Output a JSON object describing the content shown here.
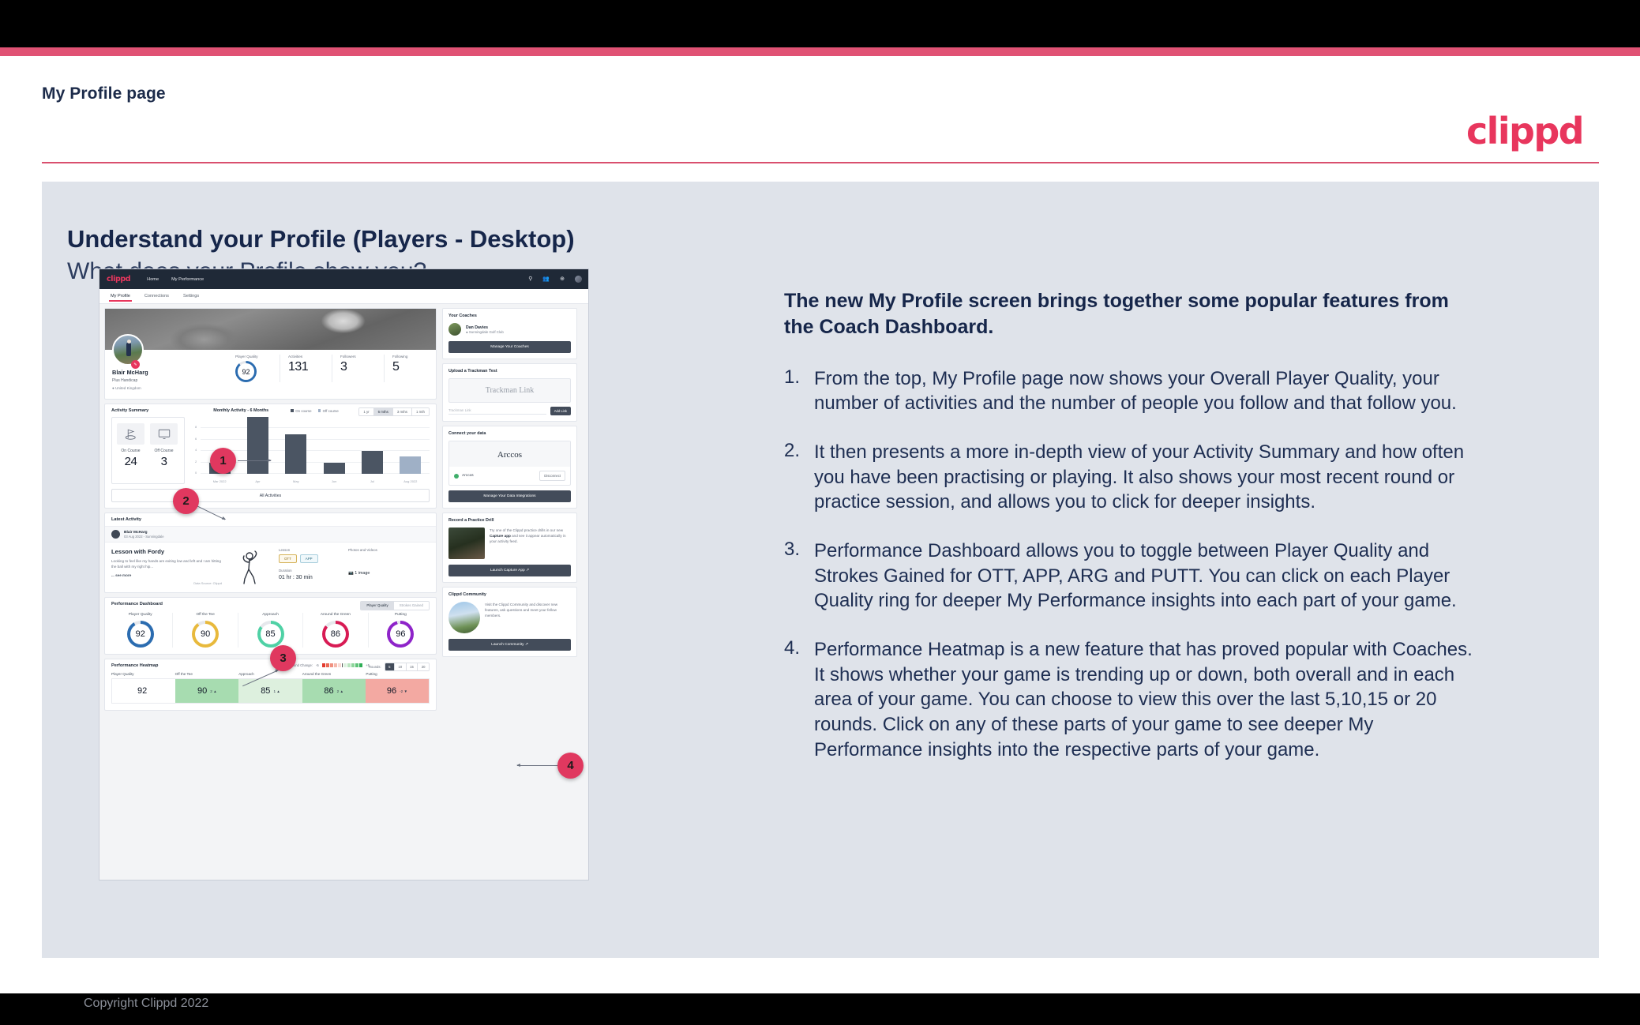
{
  "slide": {
    "page_title": "My Profile page",
    "logo": "clippd",
    "heading": "Understand your Profile (Players - Desktop)",
    "subheading": "What does your Profile show you?",
    "copyright": "Copyright Clippd 2022",
    "accent_color": "#e05274",
    "panel_color": "#dfe3ea",
    "brand_pink": "#e8365d"
  },
  "explanation": {
    "intro": "The new My Profile screen brings together some popular features from the Coach Dashboard.",
    "items": [
      {
        "num": "1.",
        "text": "From the top, My Profile page now shows your Overall Player Quality, your number of activities and the number of people you follow and that follow you."
      },
      {
        "num": "2.",
        "text": "It then presents a more in-depth view of your Activity Summary and how often you have been practising or playing. It also shows your most recent round or practice session, and allows you to click for deeper insights."
      },
      {
        "num": "3.",
        "text": "Performance Dashboard allows you to toggle between Player Quality and Strokes Gained for OTT, APP, ARG and PUTT. You can click on each Player Quality ring for deeper My Performance insights into each part of your game."
      },
      {
        "num": "4.",
        "text": "Performance Heatmap is a new feature that has proved popular with Coaches. It shows whether your game is trending up or down, both overall and in each area of your game. You can choose to view this over the last 5,10,15 or 20 rounds. Click on any of these parts of your game to see deeper My Performance insights into the respective parts of your game."
      }
    ]
  },
  "callouts": [
    {
      "label": "1"
    },
    {
      "label": "2"
    },
    {
      "label": "3"
    },
    {
      "label": "4"
    }
  ],
  "app": {
    "logo": "clippd",
    "nav": [
      "Home",
      "My Performance"
    ],
    "nav_icons": [
      "search-icon",
      "people-icon",
      "add-circle-icon",
      "avatar-icon"
    ],
    "tabs": [
      {
        "label": "My Profile",
        "active": true
      },
      {
        "label": "Connections",
        "active": false
      },
      {
        "label": "Settings",
        "active": false
      }
    ],
    "profile": {
      "name": "Blair McHarg",
      "handicap": "Plus Handicap",
      "location": "United Kingdom",
      "stats": [
        {
          "label": "Player Quality",
          "value": "92",
          "type": "ring",
          "color": "#2b6cb0"
        },
        {
          "label": "Activities",
          "value": "131"
        },
        {
          "label": "Followers",
          "value": "3"
        },
        {
          "label": "Following",
          "value": "5"
        }
      ]
    },
    "activity_summary": {
      "title": "Activity Summary",
      "chart_title": "Monthly Activity - 6 Months",
      "legend": [
        {
          "label": "On course",
          "color": "#4b5563"
        },
        {
          "label": "Off course",
          "color": "#9fb0c6"
        }
      ],
      "ranges": [
        {
          "label": "1 yr",
          "active": false
        },
        {
          "label": "6 mths",
          "active": true
        },
        {
          "label": "3 mths",
          "active": false
        },
        {
          "label": "1 mth",
          "active": false
        }
      ],
      "counters": [
        {
          "label": "On Course",
          "value": "24",
          "icon": "golf-flag-icon"
        },
        {
          "label": "Off Course",
          "value": "3",
          "icon": "monitor-icon"
        }
      ],
      "all_activities_label": "All Activities"
    },
    "latest_activity": {
      "title": "Latest Activity",
      "user": "Blair McHarg",
      "date": "03 Aug 2022 - Sunningdale",
      "lesson_title": "Lesson with Fordy",
      "description": "Looking to feel like my hands are exiting low and left and I am hitting the ball with my right hip...",
      "see_more": "... see more",
      "data_source": "Data Source: Clippd",
      "type_label": "Lesson",
      "chips": [
        "OTT",
        "APP"
      ],
      "duration_label": "Duration",
      "duration_value": "01 hr : 30 min",
      "media_label": "Photos and Videos",
      "media_value": "1 image"
    },
    "performance_dashboard": {
      "title": "Performance Dashboard",
      "toggle": [
        {
          "label": "Player Quality",
          "active": true
        },
        {
          "label": "Strokes Gained",
          "active": false
        }
      ],
      "rings": [
        {
          "label": "Player Quality",
          "value": "92",
          "color": "#2b6cb0"
        },
        {
          "label": "Off the Tee",
          "value": "90",
          "color": "#e8b93c"
        },
        {
          "label": "Approach",
          "value": "85",
          "color": "#4fd1a5"
        },
        {
          "label": "Around the Green",
          "value": "86",
          "color": "#d81b54"
        },
        {
          "label": "Putting",
          "value": "96",
          "color": "#8e24c9"
        }
      ]
    },
    "heatmap": {
      "title": "Performance Heatmap",
      "change_label": "5 Round Change:",
      "scale_min": "-5",
      "scale_max": "+5",
      "rounds_label": "Rounds:",
      "rounds": [
        {
          "label": "5",
          "active": true
        },
        {
          "label": "10",
          "active": false
        },
        {
          "label": "15",
          "active": false
        },
        {
          "label": "20",
          "active": false
        }
      ],
      "columns": [
        "Player Quality",
        "Off the Tee",
        "Approach",
        "Around the Green",
        "Putting"
      ],
      "cells": [
        {
          "value": "92",
          "delta": "",
          "bg": "#ffffff"
        },
        {
          "value": "90",
          "delta": "2 ▲",
          "bg": "#a7dcb0"
        },
        {
          "value": "85",
          "delta": "1 ▲",
          "bg": "#ddf0de"
        },
        {
          "value": "86",
          "delta": "2 ▲",
          "bg": "#a7dcb0"
        },
        {
          "value": "96",
          "delta": "-2 ▼",
          "bg": "#f3a9a2"
        }
      ]
    },
    "sidebar": {
      "coaches": {
        "title": "Your Coaches",
        "coach_name": "Dan Davies",
        "coach_club": "Sunningdale Golf Club",
        "button": "Manage Your Coaches"
      },
      "trackman": {
        "title": "Upload a Trackman Test",
        "placeholder_word": "Trackman Link",
        "input_placeholder": "Trackman Link",
        "button": "Add Link"
      },
      "connect": {
        "title": "Connect your data",
        "brand": "Arccos",
        "row_label": "Arccos",
        "disconnect": "Disconnect",
        "button": "Manage Your Data Integrations"
      },
      "drill": {
        "title": "Record a Practice Drill",
        "text_pre": "Try one of the Clippd practice drills in our new ",
        "text_bold": "Capture app",
        "text_post": " and see it appear automatically in your activity feed.",
        "button": "Launch Capture App"
      },
      "community": {
        "title": "Clippd Community",
        "text": "Visit the Clippd Community and discover new features, ask questions and meet your fellow members.",
        "button": "Launch Community"
      }
    }
  },
  "chart_data": {
    "type": "bar",
    "title": "Monthly Activity - 6 Months",
    "categories": [
      "Mar 2022",
      "Apr",
      "May",
      "Jun",
      "Jul",
      "Aug 2022"
    ],
    "values": [
      2,
      10,
      7,
      2,
      4,
      3
    ],
    "bar_types": [
      "on",
      "on",
      "on",
      "on",
      "on",
      "off"
    ],
    "series": [
      {
        "name": "On course",
        "values": [
          2,
          10,
          7,
          2,
          4,
          0
        ],
        "color": "#4b5563"
      },
      {
        "name": "Off course",
        "values": [
          0,
          0,
          0,
          0,
          0,
          3
        ],
        "color": "#9fb0c6"
      }
    ],
    "yticks": [
      "0",
      "2",
      "4",
      "6",
      "8"
    ],
    "ylim": [
      0,
      10
    ],
    "xlabel": "",
    "ylabel": "",
    "grid": true,
    "legend_position": "top"
  }
}
